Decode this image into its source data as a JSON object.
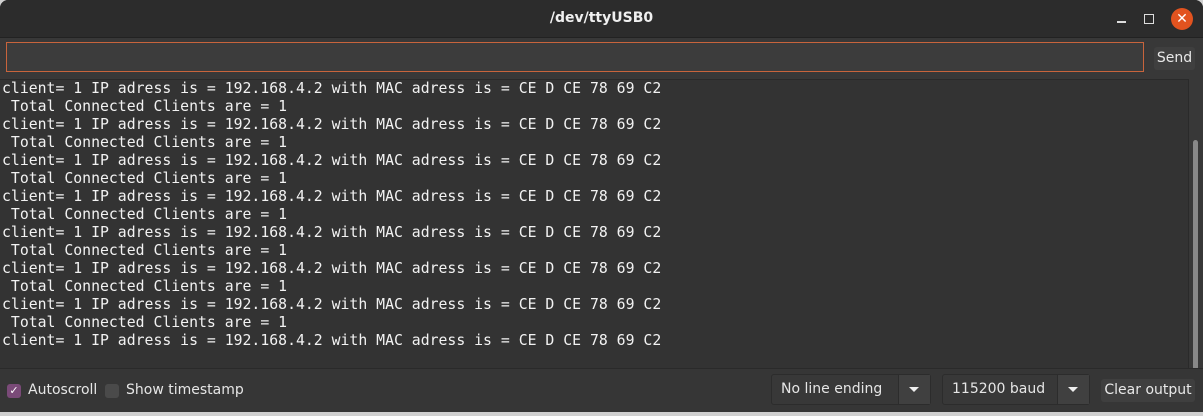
{
  "window": {
    "title": "/dev/ttyUSB0"
  },
  "input": {
    "value": "",
    "send_label": "Send"
  },
  "output": {
    "lines": [
      "client= 1 IP adress is = 192.168.4.2 with MAC adress is = CE D CE 78 69 C2",
      " Total Connected Clients are = 1",
      "client= 1 IP adress is = 192.168.4.2 with MAC adress is = CE D CE 78 69 C2",
      " Total Connected Clients are = 1",
      "client= 1 IP adress is = 192.168.4.2 with MAC adress is = CE D CE 78 69 C2",
      " Total Connected Clients are = 1",
      "client= 1 IP adress is = 192.168.4.2 with MAC adress is = CE D CE 78 69 C2",
      " Total Connected Clients are = 1",
      "client= 1 IP adress is = 192.168.4.2 with MAC adress is = CE D CE 78 69 C2",
      " Total Connected Clients are = 1",
      "client= 1 IP adress is = 192.168.4.2 with MAC adress is = CE D CE 78 69 C2",
      " Total Connected Clients are = 1",
      "client= 1 IP adress is = 192.168.4.2 with MAC adress is = CE D CE 78 69 C2",
      " Total Connected Clients are = 1",
      "client= 1 IP adress is = 192.168.4.2 with MAC adress is = CE D CE 78 69 C2"
    ]
  },
  "footer": {
    "autoscroll": {
      "label": "Autoscroll",
      "checked": true
    },
    "timestamp": {
      "label": "Show timestamp",
      "checked": false
    },
    "line_ending": "No line ending",
    "baud": "115200 baud",
    "clear_label": "Clear output"
  },
  "colors": {
    "accent": "#c8643c",
    "close": "#e2531f",
    "checkbox": "#7a4a78"
  }
}
